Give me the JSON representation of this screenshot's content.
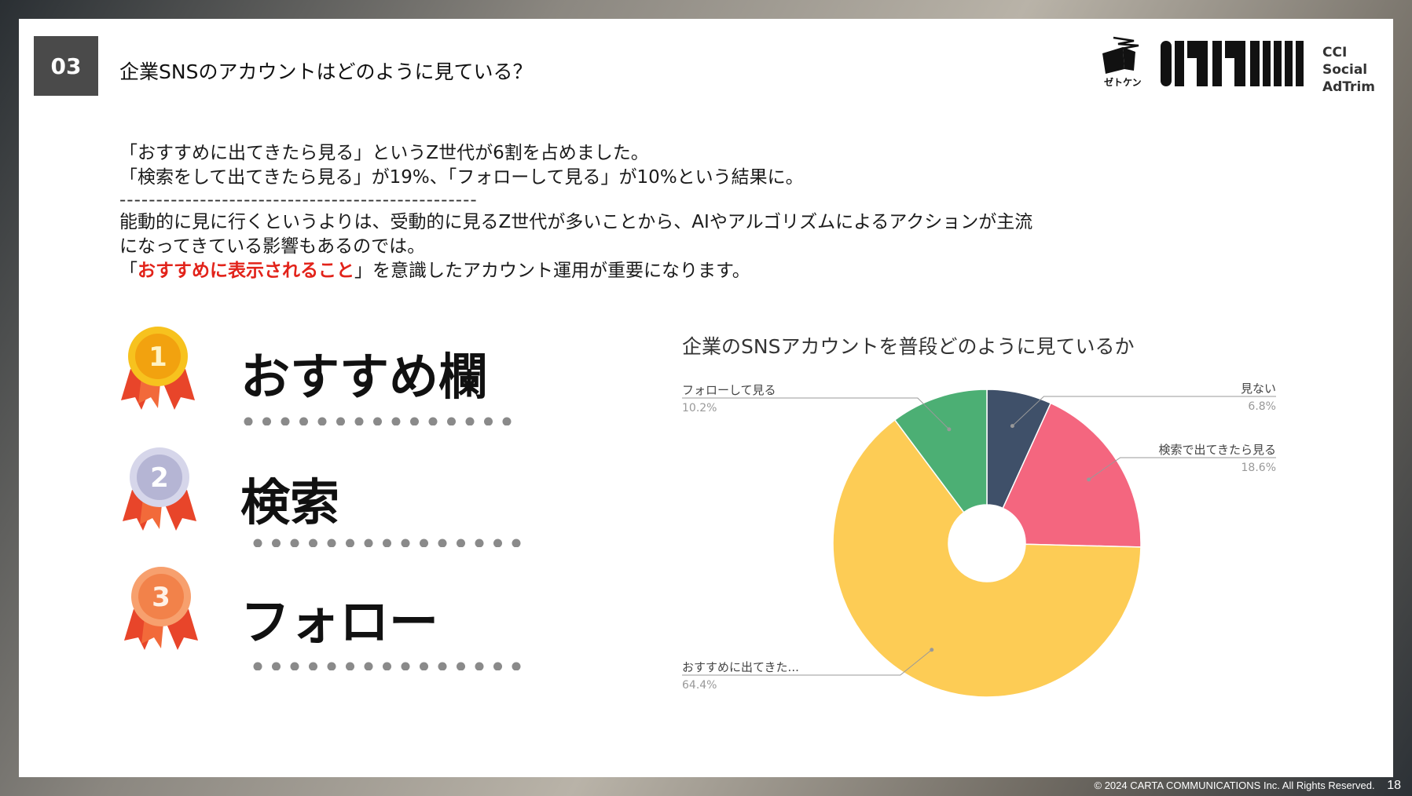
{
  "header": {
    "section_number": "03",
    "title": "企業SNSのアカウントはどのように見ている？",
    "logo_zeken": "ゼトケン",
    "logo_brand": "AdTrim",
    "logo_lines": [
      "CCI",
      "Social",
      "AdTrim"
    ]
  },
  "body": {
    "line1": "「おすすめに出てきたら見る」というZ世代が6割を占めました。",
    "line2": "「検索をして出てきたら見る」が19%、「フォローして見る」が10%という結果に。",
    "divider": "-------------------------------------------------",
    "line3": "能動的に見に行くというよりは、受動的に見るZ世代が多いことから、AIやアルゴリズムによるアクションが主流",
    "line4": "になってきている影響もあるのでは。",
    "line5_open": "「",
    "line5_highlight": "おすすめに表示されること",
    "line5_rest": "」を意識したアカウント運用が重要になります。"
  },
  "ranking": [
    {
      "rank": "1",
      "label": "おすすめ欄"
    },
    {
      "rank": "2",
      "label": "検索"
    },
    {
      "rank": "3",
      "label": "フォロー"
    }
  ],
  "colors": {
    "accent_red": "#e2231a",
    "gold": "#f5a623",
    "silver": "#b9b9d9",
    "bronze": "#f2824a",
    "ribbon": "#e8452a"
  },
  "chart_data": {
    "type": "pie",
    "title": "企業のSNSアカウントを普段どのように見ているか",
    "donut": true,
    "slices": [
      {
        "label": "見ない",
        "value": 6.8,
        "value_label": "6.8%",
        "color": "#3f5069"
      },
      {
        "label": "検索で出てきたら見る",
        "value": 18.6,
        "value_label": "18.6%",
        "color": "#f4667f"
      },
      {
        "label": "おすすめに出てきた...",
        "value": 64.4,
        "value_label": "64.4%",
        "color": "#fdcc55"
      },
      {
        "label": "フォローして見る",
        "value": 10.2,
        "value_label": "10.2%",
        "color": "#4caf74"
      }
    ]
  },
  "footer": {
    "copyright": "© 2024 CARTA COMMUNICATIONS Inc.  All Rights Reserved.",
    "page": "18"
  }
}
